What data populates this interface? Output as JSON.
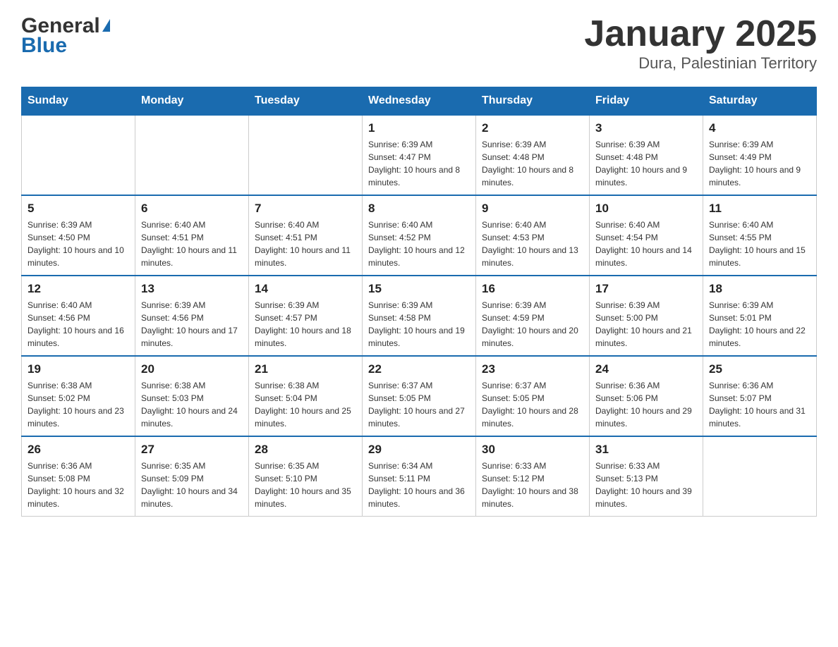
{
  "header": {
    "logo_general": "General",
    "logo_blue": "Blue",
    "month_title": "January 2025",
    "location": "Dura, Palestinian Territory"
  },
  "days_of_week": [
    "Sunday",
    "Monday",
    "Tuesday",
    "Wednesday",
    "Thursday",
    "Friday",
    "Saturday"
  ],
  "weeks": [
    [
      {
        "day": "",
        "info": ""
      },
      {
        "day": "",
        "info": ""
      },
      {
        "day": "",
        "info": ""
      },
      {
        "day": "1",
        "info": "Sunrise: 6:39 AM\nSunset: 4:47 PM\nDaylight: 10 hours and 8 minutes."
      },
      {
        "day": "2",
        "info": "Sunrise: 6:39 AM\nSunset: 4:48 PM\nDaylight: 10 hours and 8 minutes."
      },
      {
        "day": "3",
        "info": "Sunrise: 6:39 AM\nSunset: 4:48 PM\nDaylight: 10 hours and 9 minutes."
      },
      {
        "day": "4",
        "info": "Sunrise: 6:39 AM\nSunset: 4:49 PM\nDaylight: 10 hours and 9 minutes."
      }
    ],
    [
      {
        "day": "5",
        "info": "Sunrise: 6:39 AM\nSunset: 4:50 PM\nDaylight: 10 hours and 10 minutes."
      },
      {
        "day": "6",
        "info": "Sunrise: 6:40 AM\nSunset: 4:51 PM\nDaylight: 10 hours and 11 minutes."
      },
      {
        "day": "7",
        "info": "Sunrise: 6:40 AM\nSunset: 4:51 PM\nDaylight: 10 hours and 11 minutes."
      },
      {
        "day": "8",
        "info": "Sunrise: 6:40 AM\nSunset: 4:52 PM\nDaylight: 10 hours and 12 minutes."
      },
      {
        "day": "9",
        "info": "Sunrise: 6:40 AM\nSunset: 4:53 PM\nDaylight: 10 hours and 13 minutes."
      },
      {
        "day": "10",
        "info": "Sunrise: 6:40 AM\nSunset: 4:54 PM\nDaylight: 10 hours and 14 minutes."
      },
      {
        "day": "11",
        "info": "Sunrise: 6:40 AM\nSunset: 4:55 PM\nDaylight: 10 hours and 15 minutes."
      }
    ],
    [
      {
        "day": "12",
        "info": "Sunrise: 6:40 AM\nSunset: 4:56 PM\nDaylight: 10 hours and 16 minutes."
      },
      {
        "day": "13",
        "info": "Sunrise: 6:39 AM\nSunset: 4:56 PM\nDaylight: 10 hours and 17 minutes."
      },
      {
        "day": "14",
        "info": "Sunrise: 6:39 AM\nSunset: 4:57 PM\nDaylight: 10 hours and 18 minutes."
      },
      {
        "day": "15",
        "info": "Sunrise: 6:39 AM\nSunset: 4:58 PM\nDaylight: 10 hours and 19 minutes."
      },
      {
        "day": "16",
        "info": "Sunrise: 6:39 AM\nSunset: 4:59 PM\nDaylight: 10 hours and 20 minutes."
      },
      {
        "day": "17",
        "info": "Sunrise: 6:39 AM\nSunset: 5:00 PM\nDaylight: 10 hours and 21 minutes."
      },
      {
        "day": "18",
        "info": "Sunrise: 6:39 AM\nSunset: 5:01 PM\nDaylight: 10 hours and 22 minutes."
      }
    ],
    [
      {
        "day": "19",
        "info": "Sunrise: 6:38 AM\nSunset: 5:02 PM\nDaylight: 10 hours and 23 minutes."
      },
      {
        "day": "20",
        "info": "Sunrise: 6:38 AM\nSunset: 5:03 PM\nDaylight: 10 hours and 24 minutes."
      },
      {
        "day": "21",
        "info": "Sunrise: 6:38 AM\nSunset: 5:04 PM\nDaylight: 10 hours and 25 minutes."
      },
      {
        "day": "22",
        "info": "Sunrise: 6:37 AM\nSunset: 5:05 PM\nDaylight: 10 hours and 27 minutes."
      },
      {
        "day": "23",
        "info": "Sunrise: 6:37 AM\nSunset: 5:05 PM\nDaylight: 10 hours and 28 minutes."
      },
      {
        "day": "24",
        "info": "Sunrise: 6:36 AM\nSunset: 5:06 PM\nDaylight: 10 hours and 29 minutes."
      },
      {
        "day": "25",
        "info": "Sunrise: 6:36 AM\nSunset: 5:07 PM\nDaylight: 10 hours and 31 minutes."
      }
    ],
    [
      {
        "day": "26",
        "info": "Sunrise: 6:36 AM\nSunset: 5:08 PM\nDaylight: 10 hours and 32 minutes."
      },
      {
        "day": "27",
        "info": "Sunrise: 6:35 AM\nSunset: 5:09 PM\nDaylight: 10 hours and 34 minutes."
      },
      {
        "day": "28",
        "info": "Sunrise: 6:35 AM\nSunset: 5:10 PM\nDaylight: 10 hours and 35 minutes."
      },
      {
        "day": "29",
        "info": "Sunrise: 6:34 AM\nSunset: 5:11 PM\nDaylight: 10 hours and 36 minutes."
      },
      {
        "day": "30",
        "info": "Sunrise: 6:33 AM\nSunset: 5:12 PM\nDaylight: 10 hours and 38 minutes."
      },
      {
        "day": "31",
        "info": "Sunrise: 6:33 AM\nSunset: 5:13 PM\nDaylight: 10 hours and 39 minutes."
      },
      {
        "day": "",
        "info": ""
      }
    ]
  ]
}
